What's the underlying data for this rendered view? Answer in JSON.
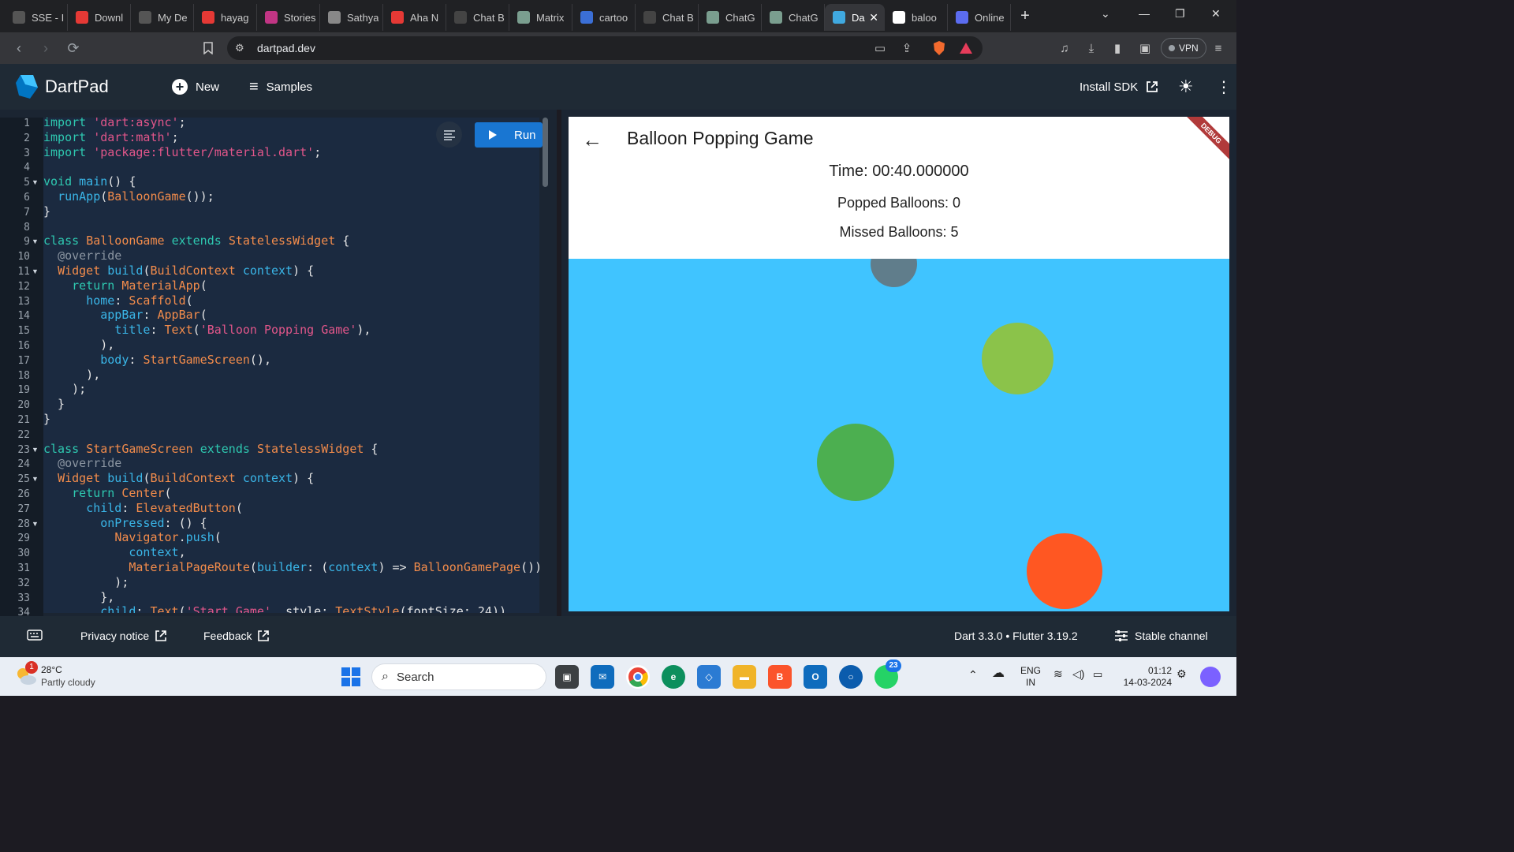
{
  "browser": {
    "tabs": [
      {
        "title": "SSE - I",
        "icon": "sse-icon",
        "color": "#555"
      },
      {
        "title": "Downl",
        "icon": "heart-icon",
        "color": "#e53935"
      },
      {
        "title": "My De",
        "icon": "hand-icon",
        "color": "#555"
      },
      {
        "title": "hayag",
        "icon": "youtube-icon",
        "color": "#e53935"
      },
      {
        "title": "Stories",
        "icon": "instagram-icon",
        "color": "#c13584"
      },
      {
        "title": "Sathya",
        "icon": "page-icon",
        "color": "#888"
      },
      {
        "title": "Aha N",
        "icon": "youtube-icon",
        "color": "#e53935"
      },
      {
        "title": "Chat B",
        "icon": "chat-icon",
        "color": "#444"
      },
      {
        "title": "Matrix",
        "icon": "openai-icon",
        "color": "#7a9e8f"
      },
      {
        "title": "cartoo",
        "icon": "p-icon",
        "color": "#3b6fd6"
      },
      {
        "title": "Chat B",
        "icon": "chat-icon",
        "color": "#444"
      },
      {
        "title": "ChatG",
        "icon": "openai-icon",
        "color": "#7a9e8f"
      },
      {
        "title": "ChatG",
        "icon": "openai-icon",
        "color": "#7a9e8f"
      },
      {
        "title": "Da",
        "icon": "dart-icon",
        "color": "#40a9e0",
        "active": true
      },
      {
        "title": "baloo",
        "icon": "github-icon",
        "color": "#fff"
      },
      {
        "title": "Online",
        "icon": "online-icon",
        "color": "#5b6cf0"
      }
    ],
    "url": "dartpad.dev",
    "vpn_label": "VPN"
  },
  "dartpad": {
    "title": "DartPad",
    "new_label": "New",
    "samples_label": "Samples",
    "install_label": "Install SDK",
    "run_label": "Run"
  },
  "editor": {
    "line_numbers": [
      "1",
      "2",
      "3",
      "4",
      "5",
      "6",
      "7",
      "8",
      "9",
      "10",
      "11",
      "12",
      "13",
      "14",
      "15",
      "16",
      "17",
      "18",
      "19",
      "20",
      "21",
      "22",
      "23",
      "24",
      "25",
      "26",
      "27",
      "28",
      "29",
      "30",
      "31",
      "32",
      "33",
      "34"
    ],
    "fold_lines": [
      "5",
      "9",
      "11",
      "23",
      "25",
      "28"
    ],
    "code_lines": [
      "import 'dart:async';",
      "import 'dart:math';",
      "import 'package:flutter/material.dart';",
      "",
      "void main() {",
      "  runApp(BalloonGame());",
      "}",
      "",
      "class BalloonGame extends StatelessWidget {",
      "  @override",
      "  Widget build(BuildContext context) {",
      "    return MaterialApp(",
      "      home: Scaffold(",
      "        appBar: AppBar(",
      "          title: Text('Balloon Popping Game'),",
      "        ),",
      "        body: StartGameScreen(),",
      "      ),",
      "    );",
      "  }",
      "}",
      "",
      "class StartGameScreen extends StatelessWidget {",
      "  @override",
      "  Widget build(BuildContext context) {",
      "    return Center(",
      "      child: ElevatedButton(",
      "        onPressed: () {",
      "          Navigator.push(",
      "            context,",
      "            MaterialPageRoute(builder: (context) => BalloonGamePage()),",
      "          );",
      "        },",
      "        child: Text('Start Game', style: TextStyle(fontSize: 24)),"
    ]
  },
  "app": {
    "title": "Balloon Popping Game",
    "time_text": "Time: 00:40.000000",
    "popped_text": "Popped Balloons: 0",
    "missed_text": "Missed Balloons: 5",
    "debug_label": "DEBUG",
    "background_color": "#40c4ff",
    "balloon_colors": [
      "#607d8b",
      "#8bc34a",
      "#4caf50",
      "#ff5722"
    ]
  },
  "footer": {
    "privacy_label": "Privacy notice",
    "feedback_label": "Feedback",
    "version_label": "Dart 3.3.0 • Flutter 3.19.2",
    "channel_label": "Stable channel"
  },
  "taskbar": {
    "weather_temp": "28°C",
    "weather_desc": "Partly cloudy",
    "weather_badge": "1",
    "search_placeholder": "Search",
    "language_line1": "ENG",
    "language_line2": "IN",
    "time": "01:12",
    "date": "14-03-2024",
    "whatsapp_badge": "23"
  }
}
